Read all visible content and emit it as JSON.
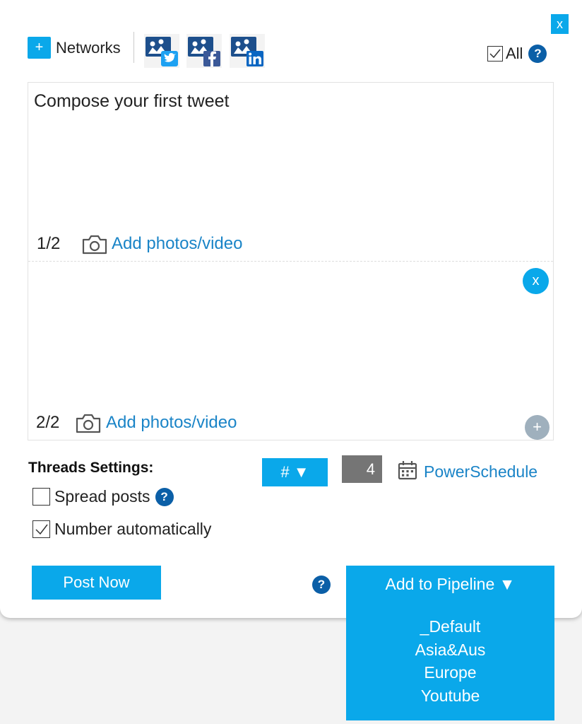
{
  "header": {
    "close_label": "x",
    "networks_plus": "+",
    "networks_label": "Networks",
    "network_icons": [
      {
        "name": "twitter-network-icon",
        "badge_color": "#1da1f2"
      },
      {
        "name": "facebook-network-icon",
        "badge_color": "#3b5998"
      },
      {
        "name": "linkedin-network-icon",
        "badge_color": "#0a66c2"
      }
    ],
    "all_label": "All",
    "all_checked": true,
    "help_label": "?"
  },
  "composer": {
    "posts": [
      {
        "text": "Compose your first tweet",
        "counter": "1/2",
        "add_media_label": "Add photos/video"
      },
      {
        "text": "",
        "counter": "2/2",
        "add_media_label": "Add photos/video",
        "remove_label": "x",
        "add_label": "+"
      }
    ]
  },
  "threads": {
    "title": "Threads Settings:",
    "spread_posts_label": "Spread posts",
    "spread_posts_checked": false,
    "number_auto_label": "Number automatically",
    "number_auto_checked": true,
    "help_label": "?",
    "numbering_format_label": "# ▼",
    "numbering_value": "4",
    "powerschedule_label": "PowerSchedule"
  },
  "footer": {
    "post_now_label": "Post Now",
    "help_label": "?",
    "pipeline_label": "Add to Pipeline ▼",
    "pipeline_options": [
      "_Default",
      "Asia&Aus",
      "Europe",
      "Youtube"
    ]
  },
  "colors": {
    "accent": "#0aa8ea",
    "help_blue": "#0b5fa7",
    "link_blue": "#1a84c7",
    "counter_gray": "#757575"
  }
}
